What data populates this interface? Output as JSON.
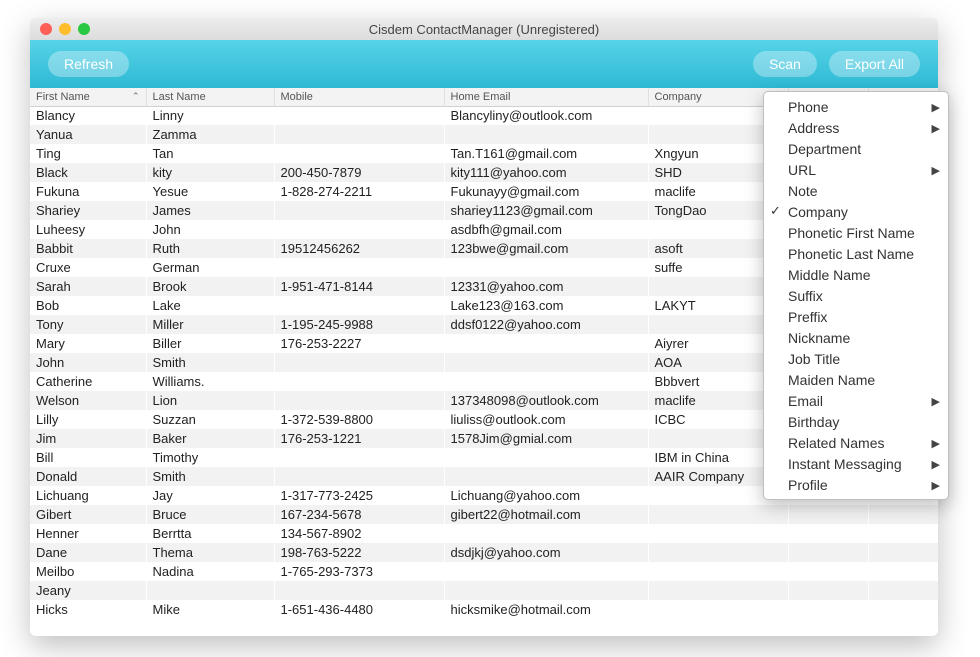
{
  "window": {
    "title": "Cisdem ContactManager (Unregistered)"
  },
  "toolbar": {
    "refresh": "Refresh",
    "scan": "Scan",
    "export_all": "Export All"
  },
  "table": {
    "columns": {
      "first_name": "First Name",
      "last_name": "Last Name",
      "mobile": "Mobile",
      "home_email": "Home Email",
      "company": "Company"
    },
    "sort_indicator": "⌃",
    "rows": [
      {
        "first": "Blancy",
        "last": "Linny",
        "mobile": "",
        "email": "Blancyliny@outlook.com",
        "company": ""
      },
      {
        "first": "Yanua",
        "last": "Zamma",
        "mobile": "",
        "email": "",
        "company": ""
      },
      {
        "first": "Ting",
        "last": "Tan",
        "mobile": "",
        "email": "Tan.T161@gmail.com",
        "company": "Xngyun"
      },
      {
        "first": "Black",
        "last": "kity",
        "mobile": "200-450-7879",
        "email": "kity111@yahoo.com",
        "company": "SHD"
      },
      {
        "first": "Fukuna",
        "last": "Yesue",
        "mobile": "1-828-274-2211",
        "email": "Fukunayy@gmail.com",
        "company": "maclife"
      },
      {
        "first": "Shariey",
        "last": "James",
        "mobile": "",
        "email": "shariey1123@gmail.com",
        "company": "TongDao"
      },
      {
        "first": "Luheesy",
        "last": "John",
        "mobile": "",
        "email": "asdbfh@gmail.com",
        "company": ""
      },
      {
        "first": "Babbit",
        "last": "Ruth",
        "mobile": "19512456262",
        "email": "123bwe@gmail.com",
        "company": "asoft"
      },
      {
        "first": "Cruxe",
        "last": "German",
        "mobile": "",
        "email": "",
        "company": "suffe"
      },
      {
        "first": "Sarah",
        "last": "Brook",
        "mobile": "1-951-471-8144",
        "email": "12331@yahoo.com",
        "company": ""
      },
      {
        "first": "Bob",
        "last": "Lake",
        "mobile": "",
        "email": "Lake123@163.com",
        "company": "LAKYT"
      },
      {
        "first": "Tony",
        "last": "Miller",
        "mobile": "1-195-245-9988",
        "email": "ddsf0122@yahoo.com",
        "company": ""
      },
      {
        "first": "Mary",
        "last": "Biller",
        "mobile": "176-253-2227",
        "email": "",
        "company": "Aiyrer"
      },
      {
        "first": "John",
        "last": "Smith",
        "mobile": "",
        "email": "",
        "company": "AOA"
      },
      {
        "first": "Catherine",
        "last": "Williams.",
        "mobile": "",
        "email": "",
        "company": "Bbbvert"
      },
      {
        "first": "Welson",
        "last": "Lion",
        "mobile": "",
        "email": "137348098@outlook.com",
        "company": "maclife"
      },
      {
        "first": "Lilly",
        "last": "Suzzan",
        "mobile": "1-372-539-8800",
        "email": "liuliss@outlook.com",
        "company": "ICBC"
      },
      {
        "first": "Jim",
        "last": "Baker",
        "mobile": "176-253-1221",
        "email": "1578Jim@gmial.com",
        "company": ""
      },
      {
        "first": "Bill",
        "last": "Timothy",
        "mobile": "",
        "email": "",
        "company": "IBM in China"
      },
      {
        "first": "Donald",
        "last": "Smith",
        "mobile": "",
        "email": "",
        "company": "AAIR Company"
      },
      {
        "first": "Lichuang",
        "last": "Jay",
        "mobile": "1-317-773-2425",
        "email": "Lichuang@yahoo.com",
        "company": ""
      },
      {
        "first": "Gibert",
        "last": "Bruce",
        "mobile": "167-234-5678",
        "email": "gibert22@hotmail.com",
        "company": ""
      },
      {
        "first": "Henner",
        "last": "Berrtta",
        "mobile": "134-567-8902",
        "email": "",
        "company": ""
      },
      {
        "first": "Dane",
        "last": "Thema",
        "mobile": "198-763-5222",
        "email": "dsdjkj@yahoo.com",
        "company": ""
      },
      {
        "first": "Meilbo",
        "last": "Nadina",
        "mobile": "1-765-293-7373",
        "email": "",
        "company": ""
      },
      {
        "first": "Jeany",
        "last": "",
        "mobile": "",
        "email": "",
        "company": ""
      },
      {
        "first": "Hicks",
        "last": "Mike",
        "mobile": "1-651-436-4480",
        "email": "hicksmike@hotmail.com",
        "company": ""
      }
    ]
  },
  "menu": {
    "items": [
      {
        "label": "Phone",
        "submenu": true,
        "checked": false
      },
      {
        "label": "Address",
        "submenu": true,
        "checked": false
      },
      {
        "label": "Department",
        "submenu": false,
        "checked": false
      },
      {
        "label": "URL",
        "submenu": true,
        "checked": false
      },
      {
        "label": "Note",
        "submenu": false,
        "checked": false
      },
      {
        "label": "Company",
        "submenu": false,
        "checked": true
      },
      {
        "label": "Phonetic First Name",
        "submenu": false,
        "checked": false
      },
      {
        "label": "Phonetic Last Name",
        "submenu": false,
        "checked": false
      },
      {
        "label": "Middle Name",
        "submenu": false,
        "checked": false
      },
      {
        "label": "Suffix",
        "submenu": false,
        "checked": false
      },
      {
        "label": "Preffix",
        "submenu": false,
        "checked": false
      },
      {
        "label": "Nickname",
        "submenu": false,
        "checked": false
      },
      {
        "label": "Job Title",
        "submenu": false,
        "checked": false
      },
      {
        "label": "Maiden Name",
        "submenu": false,
        "checked": false
      },
      {
        "label": "Email",
        "submenu": true,
        "checked": false
      },
      {
        "label": "Birthday",
        "submenu": false,
        "checked": false
      },
      {
        "label": "Related Names",
        "submenu": true,
        "checked": false
      },
      {
        "label": "Instant Messaging",
        "submenu": true,
        "checked": false
      },
      {
        "label": "Profile",
        "submenu": true,
        "checked": false
      }
    ]
  }
}
